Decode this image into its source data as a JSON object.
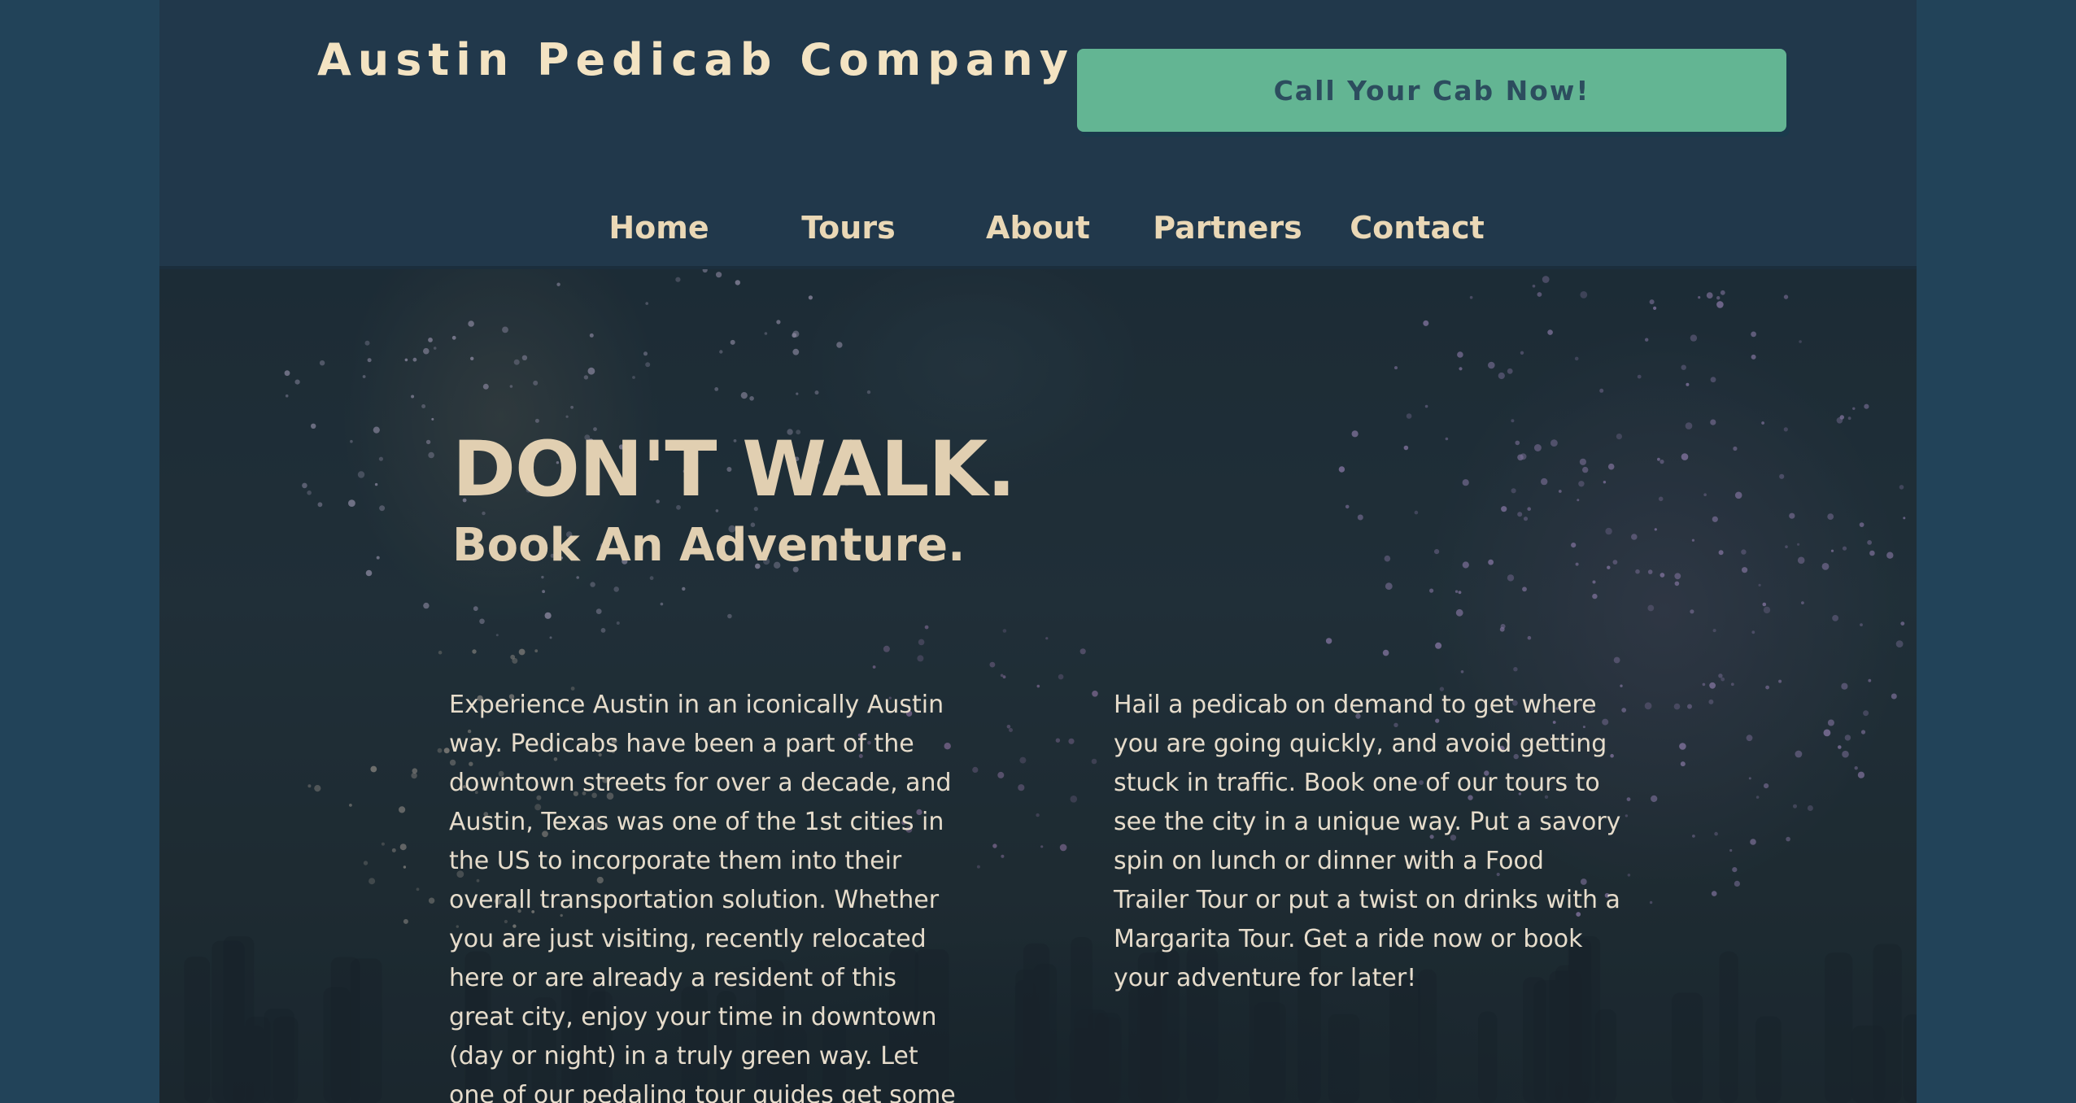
{
  "header": {
    "brand": "Austin Pedicab Company",
    "cta_label": "Call Your Cab Now!"
  },
  "nav": {
    "items": [
      {
        "label": "Home"
      },
      {
        "label": "Tours"
      },
      {
        "label": "About"
      },
      {
        "label": "Partners"
      },
      {
        "label": "Contact"
      }
    ]
  },
  "hero": {
    "headline": "DON'T WALK.",
    "subheadline": "Book An Adventure.",
    "left_text": "Experience Austin in an iconically Austin way. Pedicabs have been a part of the downtown streets for over a decade, and Austin, Texas was one of the 1st cities in the US to incorporate them into their overall transportation solution. Whether you are just visiting, recently relocated here or are already a resident of this great city, enjoy your time in downtown (day or night) in a truly green way. Let one of our pedaling tour guides get some exercise while you enjoy an",
    "right_text": "Hail a pedicab on demand to get where you are going quickly, and avoid getting stuck in traffic. Book one of our tours to see the city in a unique way. Put a savory spin on lunch or dinner with a Food Trailer Tour or put a twist on drinks with a Margarita Tour. Get a ride now or book your adventure for later!"
  },
  "colors": {
    "outer_background": "#224359",
    "header_background": "#21384b",
    "cta_background": "#63b593",
    "cta_text": "#2c4d5e",
    "brand_text": "#f3e3c2",
    "nav_text": "#ead8b6",
    "headline_text": "#e1cfb1",
    "body_text": "#e6dccb"
  }
}
